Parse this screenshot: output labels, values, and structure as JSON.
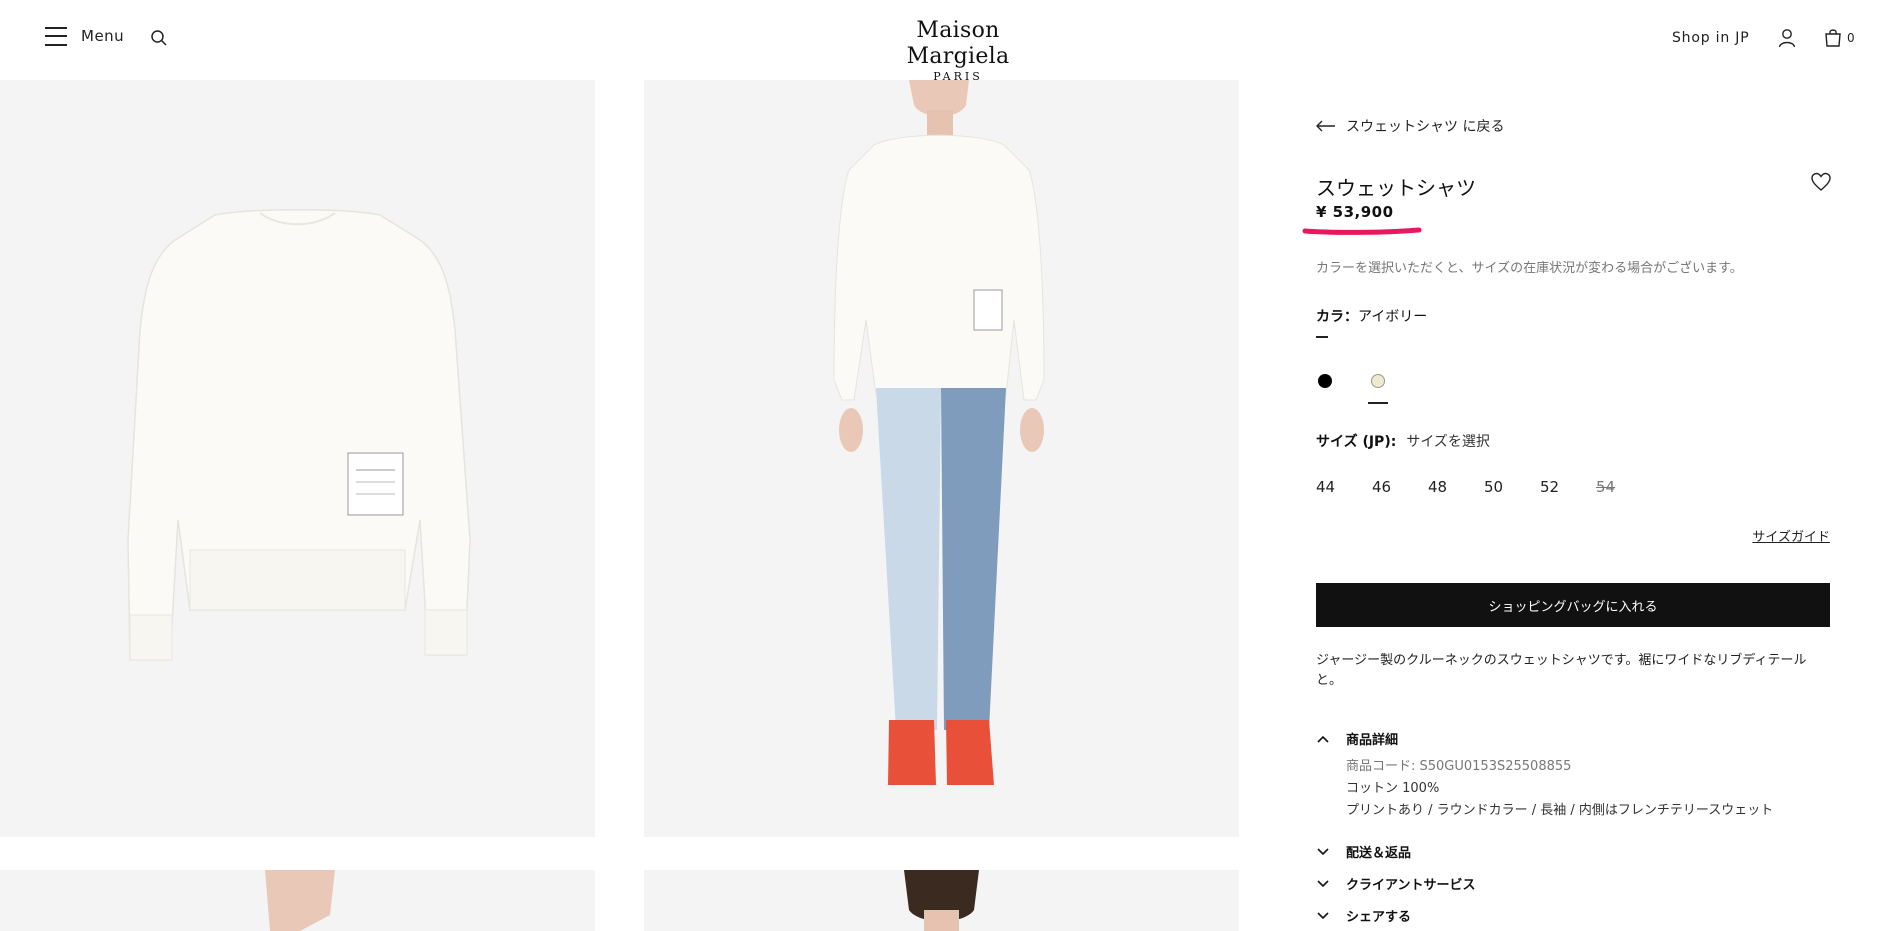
{
  "header": {
    "menu_label": "Menu",
    "brand_name": "Maison Margiela",
    "brand_sub": "PARIS",
    "shop_in": "Shop in JP",
    "bag_count": "0"
  },
  "product": {
    "back_label": "スウェットシャツ に戻る",
    "title": "スウェットシャツ",
    "price": "¥ 53,900",
    "stock_note": "カラーを選択いただくと、サイズの在庫状況が変わる場合がございます。",
    "color_label": "カラ：",
    "color_value": "アイボリー",
    "swatches": [
      {
        "name": "black",
        "color": "#000000"
      },
      {
        "name": "ivory",
        "color": "#eeeacd",
        "selected": true
      }
    ],
    "size_label": "サイズ (JP):",
    "size_value": "サイズを選択",
    "sizes": [
      {
        "label": "44",
        "available": true
      },
      {
        "label": "46",
        "available": true
      },
      {
        "label": "48",
        "available": true
      },
      {
        "label": "50",
        "available": true
      },
      {
        "label": "52",
        "available": true
      },
      {
        "label": "54",
        "available": false
      }
    ],
    "size_guide": "サイズガイド",
    "add_to_bag": "ショッピングバッグに入れる",
    "description": "ジャージー製のクルーネックのスウェットシャツです。裾にワイドなリブディテールと。",
    "details_title": "商品詳細",
    "details": [
      "商品コード: S50GU0153S25508855",
      "コットン 100%",
      "プリントあり / ラウンドカラー / 長袖 / 内側はフレンチテリースウェット"
    ],
    "sections": [
      "配送＆返品",
      "クライアントサービス",
      "シェアする"
    ]
  },
  "colors": {
    "accent_underline": "#e8185f",
    "button_bg": "#111111",
    "image_bg": "#f4f4f4"
  }
}
